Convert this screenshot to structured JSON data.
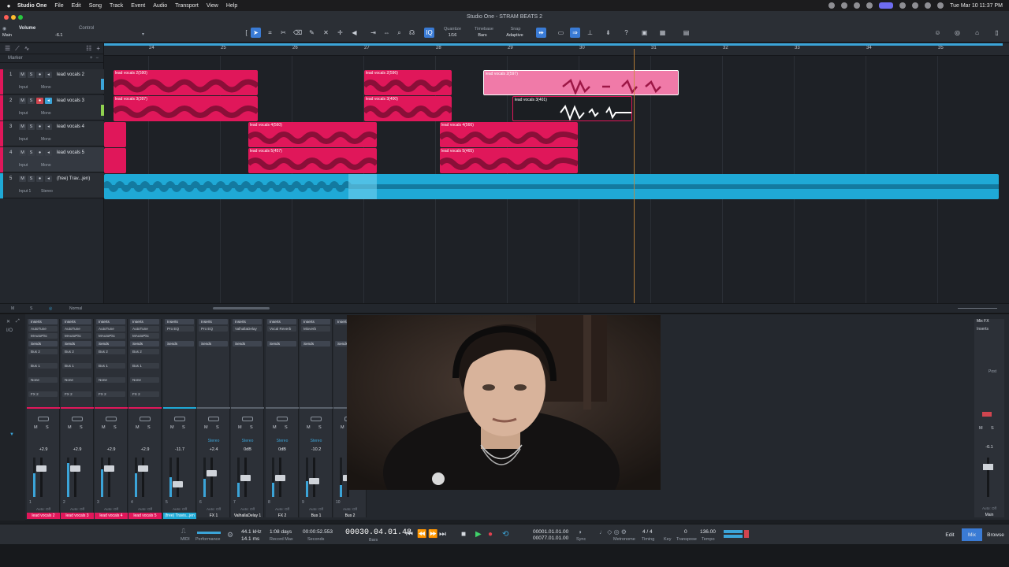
{
  "menubar": {
    "app": "Studio One",
    "items": [
      "File",
      "Edit",
      "Song",
      "Track",
      "Event",
      "Audio",
      "Transport",
      "View",
      "Help"
    ],
    "clock": "Tue Mar 10  11:37 PM"
  },
  "window": {
    "title": "Studio One - STRAM BEATS 2"
  },
  "toolbar": {
    "volume_label": "Volume",
    "control_label": "Control",
    "main_label": "Main",
    "volume_value": "-6.1",
    "quantize_label": "Quantize",
    "quantize_value": "1/16",
    "timebase_label": "Timebase",
    "timebase_value": "Bars",
    "snap_label": "Snap",
    "snap_value": "Adaptive"
  },
  "arrange": {
    "marker_label": "Marker",
    "bars": [
      "24",
      "25",
      "26",
      "27",
      "28",
      "29",
      "30",
      "31",
      "32",
      "33",
      "34",
      "35"
    ],
    "footer_mode": "Normal"
  },
  "tracks": [
    {
      "num": "1",
      "name": "lead vocals 2",
      "input": "Input",
      "mode": "Mono"
    },
    {
      "num": "2",
      "name": "lead vocals 3",
      "input": "Input",
      "mode": "Mono"
    },
    {
      "num": "3",
      "name": "lead vocals 4",
      "input": "Input",
      "mode": "Mono"
    },
    {
      "num": "4",
      "name": "lead vocals 5",
      "input": "Input",
      "mode": "Mono"
    },
    {
      "num": "5",
      "name": "(free) Trav...jen)",
      "input": "Input 1",
      "mode": "Stereo"
    }
  ],
  "clips": [
    {
      "label": "lead vocals 2(590)"
    },
    {
      "label": "lead vocals 2(596)"
    },
    {
      "label": "lead vocals 2(597)"
    },
    {
      "label": "lead vocals 3(397)"
    },
    {
      "label": "lead vocals 3(400)"
    },
    {
      "label": "lead vocals 3(401)"
    },
    {
      "label": "lead vocals 4(560)"
    },
    {
      "label": "lead vocals 4(566)"
    },
    {
      "label": "lead vocals 5(457)"
    },
    {
      "label": "lead vocals 5(465)"
    }
  ],
  "mixer": {
    "inserts_label": "Inserts",
    "sends_label": "Sends",
    "mixfx_label": "Mix FX",
    "post_label": "Post",
    "strips": [
      {
        "name": "lead vocals 2",
        "num": "1",
        "vol": "+2.9",
        "insert1": "AutoTune",
        "insert2": "MAutoPitc",
        "send1": "Bus 2",
        "send2": "Bus 1",
        "send3": "None",
        "send4": "FX 2",
        "auto": "Auto: Off"
      },
      {
        "name": "lead vocals 3",
        "num": "2",
        "vol": "+2.9",
        "insert1": "AutoTune",
        "insert2": "MAutoPitc",
        "send1": "Bus 2",
        "send2": "Bus 1",
        "send3": "None",
        "send4": "FX 2",
        "auto": "Auto: Off"
      },
      {
        "name": "lead vocals 4",
        "num": "3",
        "vol": "+2.9",
        "insert1": "AutoTune",
        "insert2": "MAutoPitc",
        "send1": "Bus 2",
        "send2": "Bus 1",
        "send3": "None",
        "send4": "FX 2",
        "auto": "Auto: Off"
      },
      {
        "name": "lead vocals 5",
        "num": "4",
        "vol": "+2.9",
        "insert1": "AutoTune",
        "insert2": "MAutoPitc",
        "send1": "Bus 2",
        "send2": "Bus 1",
        "send3": "None",
        "send4": "FX 2",
        "auto": "Auto: Off"
      },
      {
        "name": "(free) Travis...jen",
        "num": "5",
        "vol": "-11.7",
        "insert1": "Pro EQ",
        "insert2": "",
        "send1": "",
        "send2": "",
        "send3": "",
        "send4": "",
        "auto": "Auto: Off"
      },
      {
        "name": "FX 1",
        "num": "6",
        "vol": "+2.4",
        "insert1": "Pro EQ",
        "insert2": "",
        "send1": "",
        "send2": "",
        "send3": "",
        "send4": "",
        "auto": "Auto: Off",
        "stereo": "Stereo"
      },
      {
        "name": "ValhallaDelay 1",
        "num": "7",
        "vol": "0dB",
        "insert1": "ValhallaDelay",
        "insert2": "",
        "send1": "",
        "send2": "",
        "send3": "",
        "send4": "",
        "auto": "Auto: Off",
        "stereo": "Stereo"
      },
      {
        "name": "FX 2",
        "num": "8",
        "vol": "0dB",
        "insert1": "Vocal Reverb",
        "insert2": "",
        "send1": "",
        "send2": "",
        "send3": "",
        "send4": "",
        "auto": "Auto: Off",
        "stereo": "Stereo"
      },
      {
        "name": "Bus 1",
        "num": "9",
        "vol": "-10.2",
        "insert1": "Mixverb",
        "insert2": "",
        "send1": "",
        "send2": "",
        "send3": "",
        "send4": "",
        "auto": "Auto: Off",
        "stereo": "Stereo"
      },
      {
        "name": "Bus 2",
        "num": "10",
        "vol": "",
        "insert1": "",
        "insert2": "",
        "send1": "",
        "send2": "",
        "send3": "",
        "send4": "",
        "auto": "Auto: Off"
      }
    ],
    "main": {
      "name": "Main",
      "vol": "-0.1",
      "auto": "Auto: Off"
    }
  },
  "transport": {
    "midi": "MIDI",
    "performance": "Performance",
    "sample_rate": "44.1 kHz",
    "latency": "14.1 ms",
    "record_max": "1:08 days",
    "record_max_label": "Record Max",
    "time_seconds": "00:00:52.553",
    "seconds_label": "Seconds",
    "position": "00030.04.01.48",
    "bars_label": "Bars",
    "loop_start": "00001.01.01.00",
    "loop_end": "00077.01.01.00",
    "sync_label": "Sync",
    "metronome_label": "Metronome",
    "timing_value": "4 / 4",
    "timing_label": "Timing",
    "key_label": "Key",
    "transpose_value": "0",
    "transpose_label": "Transpose",
    "tempo_value": "136.00",
    "tempo_label": "Tempo",
    "tabs": [
      "Edit",
      "Mix",
      "Browse"
    ]
  },
  "colors": {
    "vocal_clip": "#e0175a",
    "vocal_clip_selected": "#f07aa8",
    "instrumental_clip": "#1fa9d6",
    "accent": "#3a7bd5"
  }
}
